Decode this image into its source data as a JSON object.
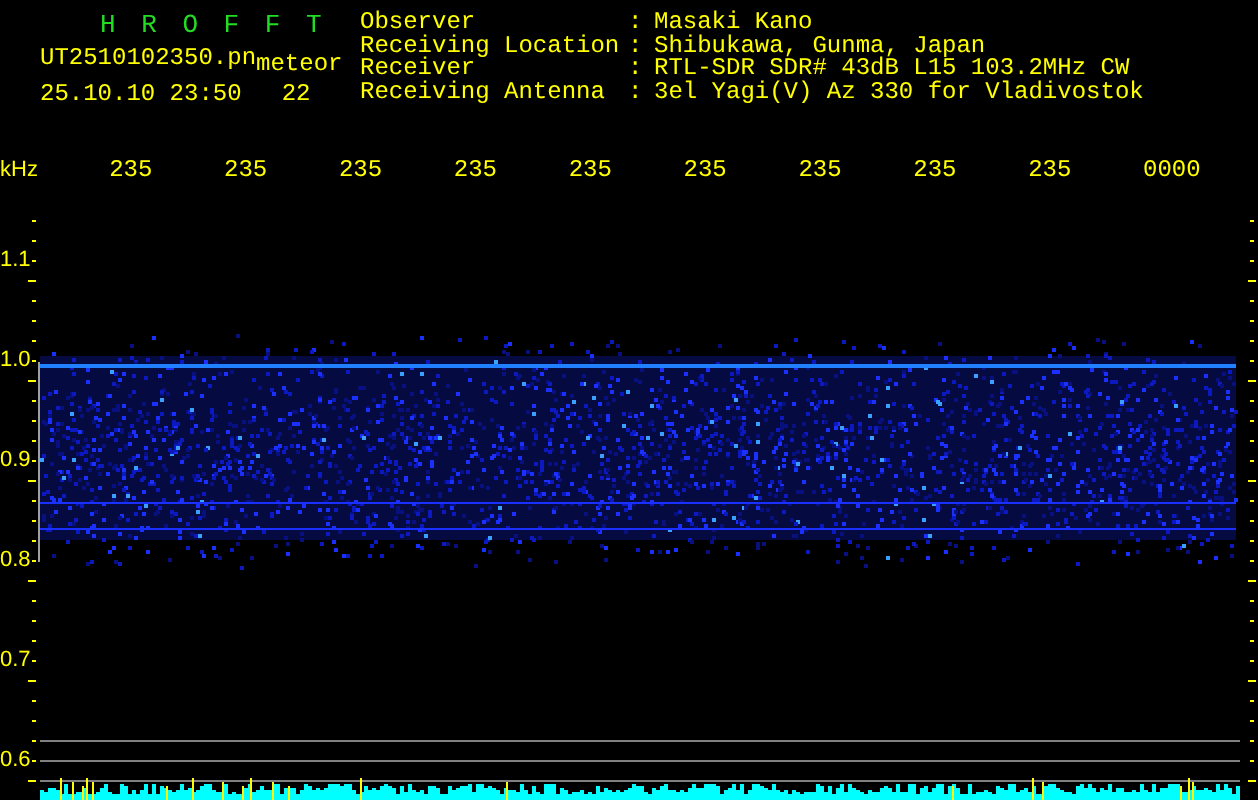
{
  "header": {
    "title": "H R O F F T",
    "file": "UT2510102350.pn",
    "file_tag": "meteor",
    "datetime": "25.10.10 23:50",
    "count": "22"
  },
  "info": [
    {
      "label": "Observer",
      "sep": ":",
      "value": "Masaki Kano"
    },
    {
      "label": "Receiving Location",
      "sep": ":",
      "value": "Shibukawa, Gunma, Japan"
    },
    {
      "label": "Receiver",
      "sep": ":",
      "value": "RTL-SDR SDR# 43dB L15 103.2MHz CW"
    },
    {
      "label": "Receiving Antenna",
      "sep": ":",
      "value": "3el Yagi(V) Az 330 for Vladivostok"
    }
  ],
  "time_axis": {
    "ticks": [
      "235",
      "235",
      "235",
      "235",
      "235",
      "235",
      "235",
      "235",
      "235",
      "0000"
    ]
  },
  "freq_axis": {
    "unit": "kHz",
    "ticks": [
      "1.1",
      "1.0",
      "0.9",
      "0.8",
      "0.7",
      "0.6"
    ]
  }
}
